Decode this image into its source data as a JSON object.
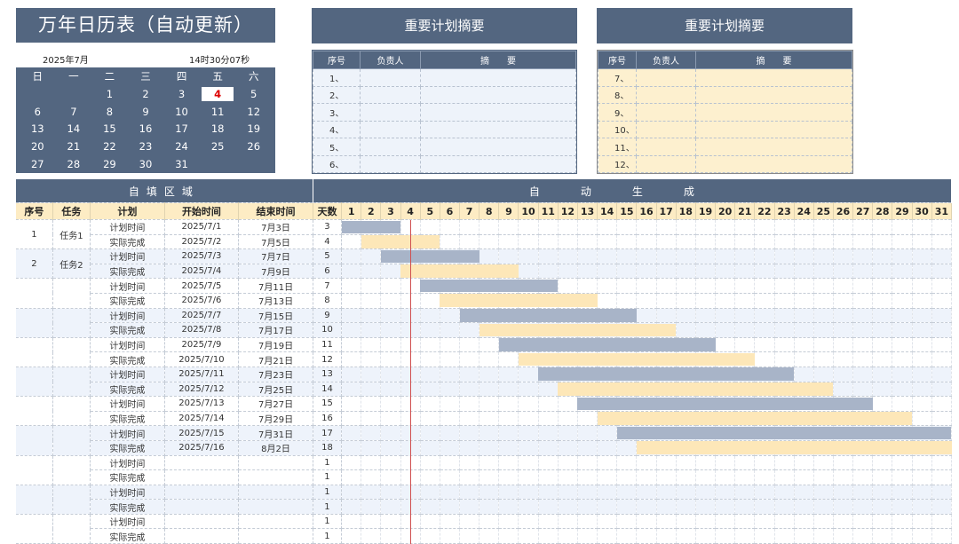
{
  "calendar": {
    "title": "万年日历表（自动更新）",
    "year_month": "2025年7月",
    "time": "14时30分07秒",
    "weekdays": [
      "日",
      "一",
      "二",
      "三",
      "四",
      "五",
      "六"
    ],
    "weeks": [
      [
        "",
        "",
        "1",
        "2",
        "3",
        "4",
        "5"
      ],
      [
        "6",
        "7",
        "8",
        "9",
        "10",
        "11",
        "12"
      ],
      [
        "13",
        "14",
        "15",
        "16",
        "17",
        "18",
        "19"
      ],
      [
        "20",
        "21",
        "22",
        "23",
        "24",
        "25",
        "26"
      ],
      [
        "27",
        "28",
        "29",
        "30",
        "31",
        "",
        ""
      ]
    ],
    "today": "4"
  },
  "summary_left": {
    "title": "重要计划摘要",
    "headers": [
      "序号",
      "负责人",
      "摘　　要"
    ],
    "rows": [
      "1、",
      "2、",
      "3、",
      "4、",
      "5、",
      "6、"
    ]
  },
  "summary_right": {
    "title": "重要计划摘要",
    "headers": [
      "序号",
      "负责人",
      "摘　　要"
    ],
    "rows": [
      "7、",
      "8、",
      "9、",
      "10、",
      "11、",
      "12、"
    ]
  },
  "gantt": {
    "section_left": "自填区域",
    "section_right": "自动生成",
    "headers": [
      "序号",
      "任务",
      "计划",
      "开始时间",
      "结束时间",
      "天数"
    ],
    "days": [
      "1",
      "2",
      "3",
      "4",
      "5",
      "6",
      "7",
      "8",
      "9",
      "10",
      "11",
      "12",
      "13",
      "14",
      "15",
      "16",
      "17",
      "18",
      "19",
      "20",
      "21",
      "22",
      "23",
      "24",
      "25",
      "26",
      "27",
      "28",
      "29",
      "30",
      "31"
    ],
    "today_day": 4,
    "rows": [
      {
        "seq": "1",
        "task": "任务1",
        "plan": "计划时间",
        "start": "2025/7/1",
        "end": "7月3日",
        "days": "3",
        "type": "plan"
      },
      {
        "seq": "",
        "task": "",
        "plan": "实际完成",
        "start": "2025/7/2",
        "end": "7月5日",
        "days": "4",
        "type": "act"
      },
      {
        "seq": "2",
        "task": "任务2",
        "plan": "计划时间",
        "start": "2025/7/3",
        "end": "7月7日",
        "days": "5",
        "type": "plan"
      },
      {
        "seq": "",
        "task": "",
        "plan": "实际完成",
        "start": "2025/7/4",
        "end": "7月9日",
        "days": "6",
        "type": "act"
      },
      {
        "seq": "",
        "task": "",
        "plan": "计划时间",
        "start": "2025/7/5",
        "end": "7月11日",
        "days": "7",
        "type": "plan"
      },
      {
        "seq": "",
        "task": "",
        "plan": "实际完成",
        "start": "2025/7/6",
        "end": "7月13日",
        "days": "8",
        "type": "act"
      },
      {
        "seq": "",
        "task": "",
        "plan": "计划时间",
        "start": "2025/7/7",
        "end": "7月15日",
        "days": "9",
        "type": "plan"
      },
      {
        "seq": "",
        "task": "",
        "plan": "实际完成",
        "start": "2025/7/8",
        "end": "7月17日",
        "days": "10",
        "type": "act"
      },
      {
        "seq": "",
        "task": "",
        "plan": "计划时间",
        "start": "2025/7/9",
        "end": "7月19日",
        "days": "11",
        "type": "plan"
      },
      {
        "seq": "",
        "task": "",
        "plan": "实际完成",
        "start": "2025/7/10",
        "end": "7月21日",
        "days": "12",
        "type": "act"
      },
      {
        "seq": "",
        "task": "",
        "plan": "计划时间",
        "start": "2025/7/11",
        "end": "7月23日",
        "days": "13",
        "type": "plan"
      },
      {
        "seq": "",
        "task": "",
        "plan": "实际完成",
        "start": "2025/7/12",
        "end": "7月25日",
        "days": "14",
        "type": "act"
      },
      {
        "seq": "",
        "task": "",
        "plan": "计划时间",
        "start": "2025/7/13",
        "end": "7月27日",
        "days": "15",
        "type": "plan"
      },
      {
        "seq": "",
        "task": "",
        "plan": "实际完成",
        "start": "2025/7/14",
        "end": "7月29日",
        "days": "16",
        "type": "act"
      },
      {
        "seq": "",
        "task": "",
        "plan": "计划时间",
        "start": "2025/7/15",
        "end": "7月31日",
        "days": "17",
        "type": "plan"
      },
      {
        "seq": "",
        "task": "",
        "plan": "实际完成",
        "start": "2025/7/16",
        "end": "8月2日",
        "days": "18",
        "type": "act"
      },
      {
        "seq": "",
        "task": "",
        "plan": "计划时间",
        "start": "",
        "end": "",
        "days": "1",
        "type": "none"
      },
      {
        "seq": "",
        "task": "",
        "plan": "实际完成",
        "start": "",
        "end": "",
        "days": "1",
        "type": "none"
      },
      {
        "seq": "",
        "task": "",
        "plan": "计划时间",
        "start": "",
        "end": "",
        "days": "1",
        "type": "none"
      },
      {
        "seq": "",
        "task": "",
        "plan": "实际完成",
        "start": "",
        "end": "",
        "days": "1",
        "type": "none"
      },
      {
        "seq": "",
        "task": "",
        "plan": "计划时间",
        "start": "",
        "end": "",
        "days": "1",
        "type": "none"
      },
      {
        "seq": "",
        "task": "",
        "plan": "实际完成",
        "start": "",
        "end": "",
        "days": "1",
        "type": "none"
      }
    ]
  },
  "colors": {
    "header": "#536680",
    "plan_bar": "#a8b4c8",
    "actual_bar": "#fde7b8",
    "today_line": "#d05050"
  }
}
